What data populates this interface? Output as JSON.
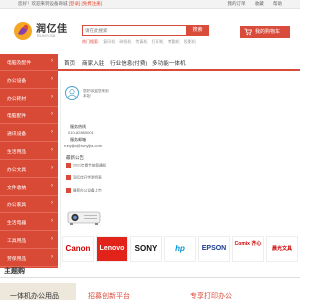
{
  "topbar": {
    "welcome": "您好！欢迎来到设备商城",
    "login": "[登录]",
    "register": "[免费注册]",
    "links": [
      "我的订单",
      "收藏",
      "帮助"
    ]
  },
  "header": {
    "logo_name": "润亿佳",
    "logo_sub": "RUNYIJIA",
    "search_placeholder": "请在此搜索",
    "search_button": "搜索",
    "hot_words": [
      "热门搜索:",
      "复印机",
      "碎纸机",
      "传真机",
      "打印机",
      "考勤机",
      "投影机"
    ],
    "cart_label": "我的购物车"
  },
  "sidebar": {
    "categories": [
      "电脑及配件",
      "办公设备",
      "办公耗材",
      "电脑配件",
      "通讯设备",
      "生活用品",
      "办公文具",
      "文件收纳",
      "办公家具",
      "生活电器",
      "工具用品",
      "劳保用品"
    ]
  },
  "nav": {
    "items": [
      "首页",
      "商家入驻",
      "行业信息(付费)",
      "多功能一体机"
    ]
  },
  "service": {
    "hello_line1": "您好!欢迎您来到",
    "hello_line2": "本站!",
    "hotline_title": "服务热线",
    "hotline": "010-82865001",
    "email_title": "服务邮箱",
    "email": "runyijia@runyijia.com",
    "notice_title": "最新公告",
    "notices": [
      "2021年春节放假通知",
      "润亿佳开学季特惠",
      "最新办公设备上市"
    ]
  },
  "brands": [
    {
      "name": "Canon",
      "color": "#cc0000"
    },
    {
      "name": "Lenovo",
      "color": "#ffffff",
      "bg": "#e2231a"
    },
    {
      "name": "SONY",
      "color": "#111111"
    },
    {
      "name": "hp",
      "color": "#0096d6"
    },
    {
      "name": "EPSON",
      "color": "#1a3a8f"
    },
    {
      "name": "Comix 齐心",
      "color": "#cc0000"
    },
    {
      "name": "晨光文具",
      "color": "#cc0000"
    }
  ],
  "section": {
    "title": "主题购",
    "cards": [
      "一体机办公用品",
      "招募创新平台",
      "专享打印办公"
    ]
  }
}
